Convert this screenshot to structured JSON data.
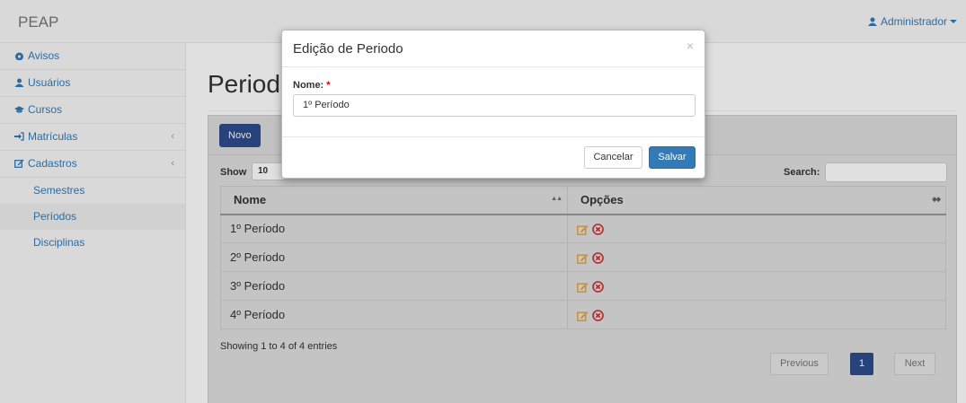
{
  "navbar": {
    "brand": "PEAP",
    "user": "Administrador"
  },
  "sidebar": {
    "items": [
      {
        "label": "Avisos"
      },
      {
        "label": "Usuários"
      },
      {
        "label": "Cursos"
      },
      {
        "label": "Matrículas",
        "chevron": "‹"
      },
      {
        "label": "Cadastros",
        "chevron": "‹"
      }
    ],
    "sub_items": [
      {
        "label": "Semestres"
      },
      {
        "label": "Períodos"
      },
      {
        "label": "Disciplinas"
      }
    ]
  },
  "main": {
    "title": "Periodos",
    "new_button": "Novo",
    "show_label": "Show",
    "show_value": "10",
    "search_label": "Search:",
    "table": {
      "headers": [
        "Nome",
        "Opções"
      ],
      "rows": [
        {
          "nome": "1º Período"
        },
        {
          "nome": "2º Período"
        },
        {
          "nome": "3º Período"
        },
        {
          "nome": "4º Período"
        }
      ]
    },
    "showing": "Showing 1 to 4 of 4 entries",
    "pagination": {
      "previous": "Previous",
      "current": "1",
      "next": "Next"
    }
  },
  "modal": {
    "title": "Edição de Periodo",
    "close": "×",
    "field_label": "Nome:",
    "required_mark": "*",
    "field_value": "1º Período",
    "cancel": "Cancelar",
    "save": "Salvar"
  },
  "colors": {
    "primary": "#337ab7",
    "dark_primary": "#2e4d8c",
    "edit_icon": "#e6a23c",
    "delete_icon": "#c9302c"
  }
}
